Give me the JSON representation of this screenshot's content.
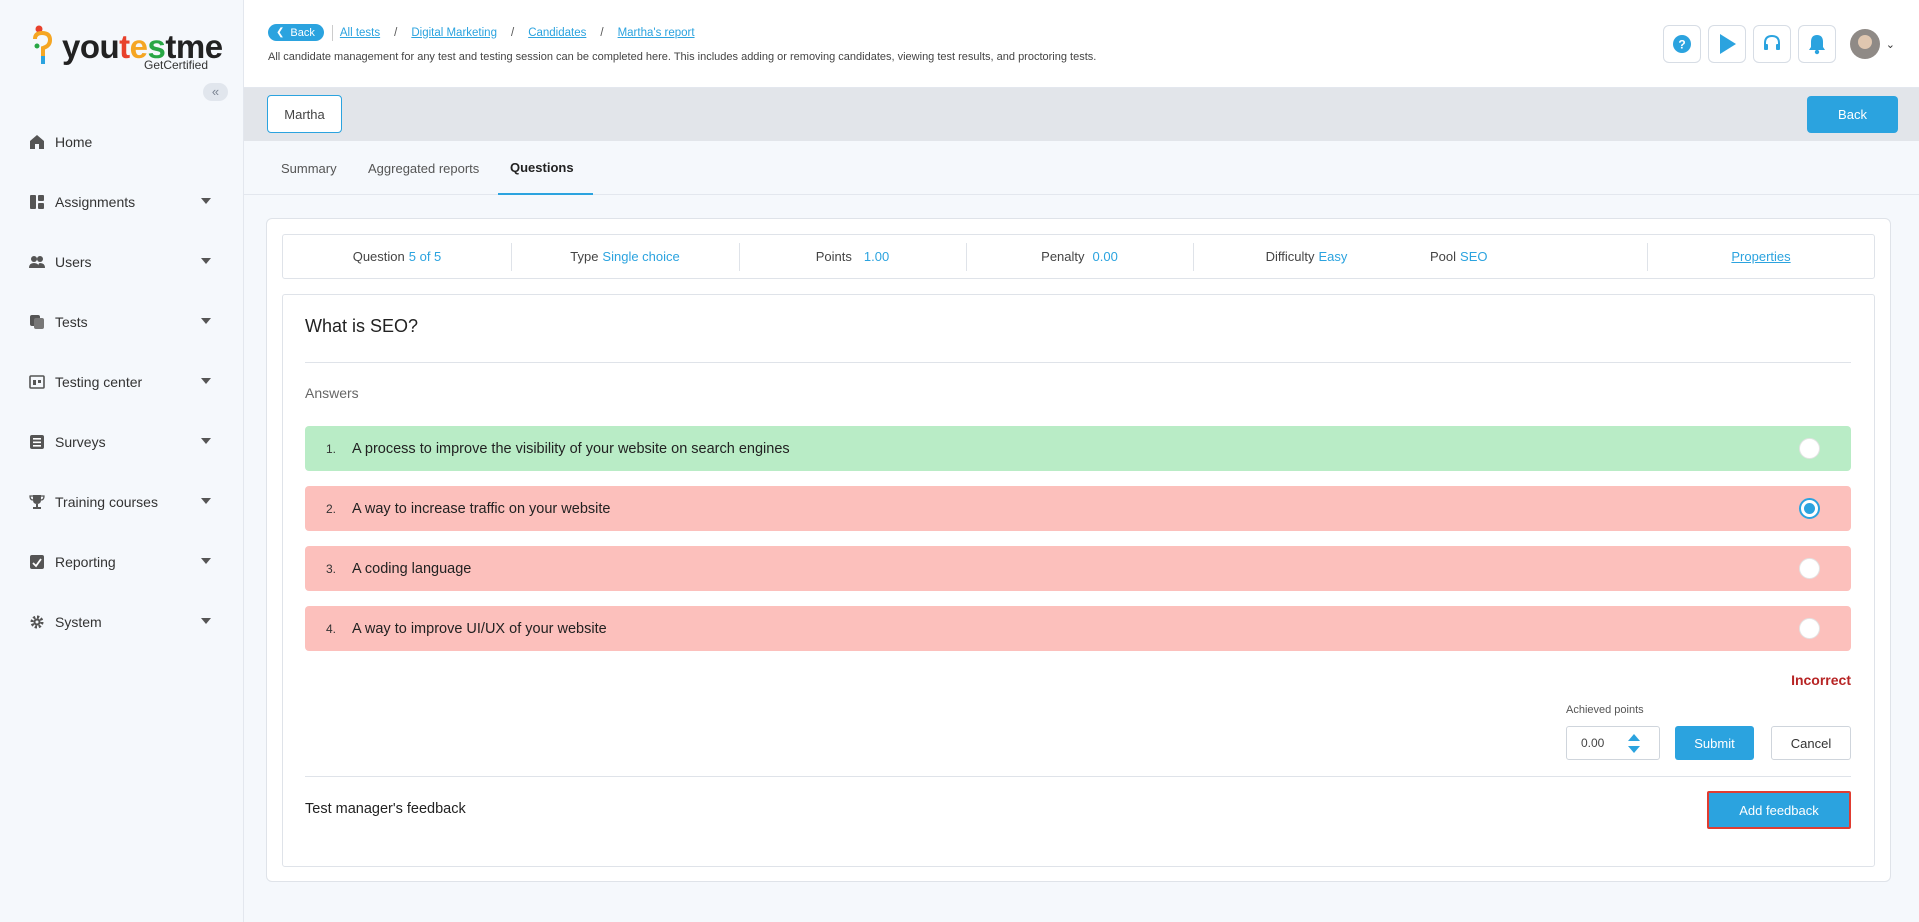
{
  "logo": {
    "word_parts": [
      "you",
      "t",
      "e",
      "s",
      "tme"
    ],
    "sub": "GetCertified"
  },
  "sidebar": {
    "collapse_icon": "«",
    "items": [
      {
        "label": "Home",
        "icon": "home-icon",
        "has_caret": false
      },
      {
        "label": "Assignments",
        "icon": "assignments-icon",
        "has_caret": true
      },
      {
        "label": "Users",
        "icon": "users-icon",
        "has_caret": true
      },
      {
        "label": "Tests",
        "icon": "tests-icon",
        "has_caret": true
      },
      {
        "label": "Testing center",
        "icon": "testing-center-icon",
        "has_caret": true
      },
      {
        "label": "Surveys",
        "icon": "surveys-icon",
        "has_caret": true
      },
      {
        "label": "Training courses",
        "icon": "trophy-icon",
        "has_caret": true
      },
      {
        "label": "Reporting",
        "icon": "reporting-icon",
        "has_caret": true
      },
      {
        "label": "System",
        "icon": "gear-icon",
        "has_caret": true
      }
    ]
  },
  "header": {
    "back_label": "Back",
    "breadcrumbs": [
      "All tests",
      "Digital Marketing",
      "Candidates",
      "Martha's report"
    ],
    "description": "All candidate management for any test and testing session can be completed here. This includes adding or removing candidates, viewing test results, and proctoring tests.",
    "icons": [
      "help-icon",
      "play-icon",
      "headset-icon",
      "bell-icon"
    ]
  },
  "subbar": {
    "candidate_label": "Martha",
    "back_label": "Back"
  },
  "tabs": [
    {
      "label": "Summary",
      "active": false
    },
    {
      "label": "Aggregated reports",
      "active": false
    },
    {
      "label": "Questions",
      "active": true
    }
  ],
  "meta": {
    "question_label": "Question",
    "question_value": "5 of 5",
    "type_label": "Type",
    "type_value": "Single choice",
    "points_label": "Points",
    "points_value": "1.00",
    "penalty_label": "Penalty",
    "penalty_value": "0.00",
    "difficulty_label": "Difficulty",
    "difficulty_value": "Easy",
    "pool_label": "Pool",
    "pool_value": "SEO",
    "properties_label": "Properties"
  },
  "question": {
    "title": "What is SEO?",
    "answers_label": "Answers",
    "answers": [
      {
        "num": "1.",
        "text": "A process to improve the visibility of your website on search engines",
        "status": "correct",
        "selected": false
      },
      {
        "num": "2.",
        "text": "A way to increase traffic on your website",
        "status": "wrong",
        "selected": true
      },
      {
        "num": "3.",
        "text": "A coding language",
        "status": "wrong",
        "selected": false
      },
      {
        "num": "4.",
        "text": "A way to improve UI/UX of your website",
        "status": "wrong",
        "selected": false
      }
    ],
    "result_label": "Incorrect",
    "achieved_points_label": "Achieved points",
    "achieved_points_value": "0.00",
    "submit_label": "Submit",
    "cancel_label": "Cancel",
    "feedback_label": "Test manager's feedback",
    "add_feedback_label": "Add feedback"
  },
  "colors": {
    "accent": "#2ba3df",
    "correct_bg": "#b9ecc6",
    "wrong_bg": "#fcc0bc",
    "incorrect_text": "#b72424"
  }
}
